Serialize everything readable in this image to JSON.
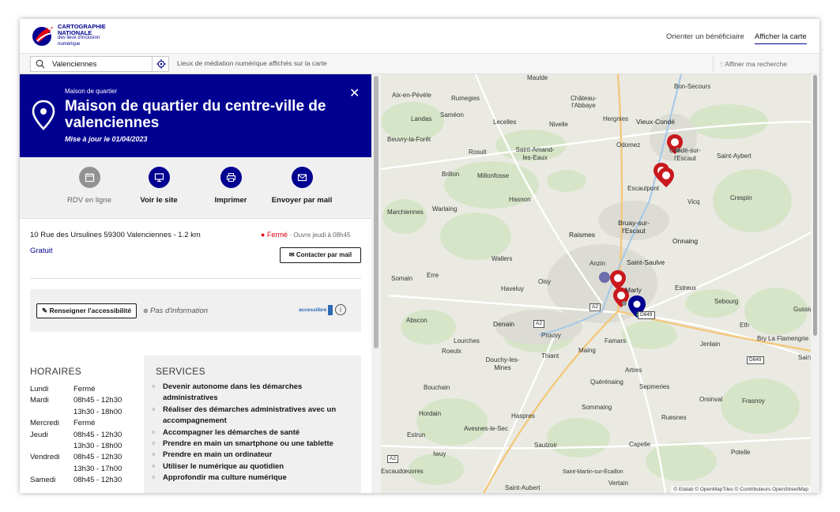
{
  "header": {
    "brand_line1": "CARTOGRAPHIE",
    "brand_line2": "NATIONALE",
    "brand_line3": "des lieux d'inclusion",
    "brand_line4": "numérique",
    "nav": [
      {
        "label": "Orienter un bénéficiaire"
      },
      {
        "label": "Afficher la carte"
      }
    ]
  },
  "search": {
    "value": "Valenciennes",
    "results_text": "Lieux de médiation numérique affichés sur la carte",
    "refine_label": "Affiner ma recherche"
  },
  "place": {
    "type": "Maison de quartier",
    "name": "Maison de quartier du centre-ville de valenciennes",
    "updated": "Mise à jour le 01/04/2023",
    "address": "10 Rue des Ursulines 59300 Valenciennes - 1.2 km",
    "status_closed": "Fermé",
    "status_opens": "· Ouvre jeudi à 08h45",
    "price": "Gratuit",
    "contact_label": "Contacter par mail"
  },
  "actions": [
    {
      "label": "RDV en ligne",
      "icon": "calendar-icon",
      "enabled": false
    },
    {
      "label": "Voir le site",
      "icon": "monitor-icon",
      "enabled": true
    },
    {
      "label": "Imprimer",
      "icon": "printer-icon",
      "enabled": true
    },
    {
      "label": "Envoyer par mail",
      "icon": "mail-icon",
      "enabled": true
    }
  ],
  "accessibility": {
    "button_label": "Renseigner l'accessibilité",
    "info": "Pas d'information",
    "logo_text": "accesslibre"
  },
  "hours": {
    "title": "HORAIRES",
    "rows": [
      {
        "day": "Lundi",
        "time": "Fermé"
      },
      {
        "day": "Mardi",
        "time": "08h45 - 12h30"
      },
      {
        "day": "",
        "time": "13h30 - 18h00"
      },
      {
        "day": "Mercredi",
        "time": "Fermé"
      },
      {
        "day": "Jeudi",
        "time": "08h45 - 12h30"
      },
      {
        "day": "",
        "time": "13h30 - 18h00"
      },
      {
        "day": "Vendredi",
        "time": "08h45 - 12h30"
      },
      {
        "day": "",
        "time": "13h30 - 17h00"
      },
      {
        "day": "Samedi",
        "time": "08h45 - 12h30"
      }
    ]
  },
  "services": {
    "title": "SERVICES",
    "items": [
      "Devenir autonome dans les démarches administratives",
      "Réaliser des démarches administratives avec un accompagnement",
      "Accompagner les démarches de santé",
      "Prendre en main un smartphone ou une tablette",
      "Prendre en main un ordinateur",
      "Utiliser le numérique au quotidien",
      "Approfondir ma culture numérique"
    ]
  },
  "map": {
    "attribution": "© Etalab © OpenMapTiles © Contributeurs OpenStreetMap",
    "places": [
      "Aix-en-Pévèle",
      "Rumegies",
      "Château-l'Abbaye",
      "Maulde",
      "Bon-Secours",
      "Landas",
      "Saméon",
      "Lecelles",
      "Nivelle",
      "Hergnies",
      "Vieux-Condé",
      "Beuvry-la-Forêt",
      "Rosult",
      "Saint-Amand-les-Eaux",
      "Odomez",
      "Condé-sur-l'Escaut",
      "Saint-Aybert",
      "Brillon",
      "Millonfosse",
      "Escautpont",
      "Hasnon",
      "Crespin",
      "Marchiennes",
      "Warlaing",
      "Vicq",
      "Bruay-sur-l'Escaut",
      "Raismes",
      "Onnaing",
      "Wallers",
      "Anzin",
      "Saint-Saulve",
      "Somain",
      "Erre",
      "Haveluy",
      "Oisy",
      "Marly",
      "Estreux",
      "Sebourg",
      "Abscon",
      "Denain",
      "Prouvy",
      "Eth",
      "Lourches",
      "Famars",
      "Jenlain",
      "Bry",
      "La Flamengrie",
      "Roeulx",
      "Thiant",
      "Maing",
      "Douchy-les-Mines",
      "Artres",
      "Bouchain",
      "Quérénaing",
      "Sepmeries",
      "Sommaing",
      "Orsinval",
      "Frasnoy",
      "Hordain",
      "Haspres",
      "Ruesnes",
      "Avesnes-le-Sec",
      "Estrun",
      "Saulzoir",
      "Capelle",
      "Potelle",
      "Iwuy",
      "Escaudœuvres",
      "Saint-Aubert",
      "Vertain",
      "Saint-Martin-sur-Écaillon",
      "Gussignies",
      "Saint"
    ],
    "roads": [
      "A2",
      "A2",
      "A2",
      "D649",
      "D649"
    ]
  },
  "colors": {
    "primary": "#000091",
    "closed": "#e1000f",
    "pin_red": "#c9191e"
  }
}
